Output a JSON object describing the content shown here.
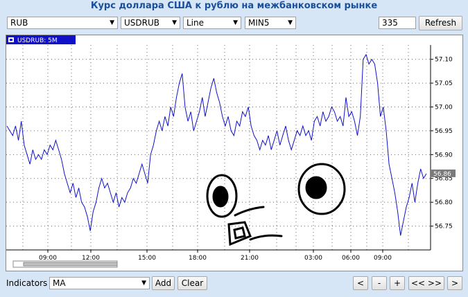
{
  "title": "Курс доллара США к рублю на межбанковском рынке",
  "toolbar": {
    "currency": "RUB",
    "pair": "USDRUB",
    "chart_type": "Line",
    "interval": "MIN5",
    "count": "335",
    "refresh_label": "Refresh"
  },
  "legend": {
    "label": "USDRUB: 5M"
  },
  "current_value_label": "56.86",
  "indicators": {
    "label": "Indicators",
    "selected": "MA",
    "add_label": "Add",
    "clear_label": "Clear"
  },
  "nav": {
    "back": "<",
    "zoom_out": "-",
    "zoom_in": "+",
    "expand": "<< >>",
    "forward": ">"
  },
  "colors": {
    "line": "#1010c8",
    "title": "#1a4f9c",
    "legend_bg": "#1010c8",
    "value_badge": "#7a7a7a"
  },
  "chart_data": {
    "type": "line",
    "series": [
      {
        "name": "USDRUB: 5M",
        "values": [
          56.96,
          56.95,
          56.94,
          56.96,
          56.93,
          56.97,
          56.92,
          56.9,
          56.88,
          56.91,
          56.89,
          56.9,
          56.89,
          56.91,
          56.9,
          56.92,
          56.91,
          56.93,
          56.91,
          56.89,
          56.86,
          56.84,
          56.82,
          56.84,
          56.81,
          56.83,
          56.8,
          56.79,
          56.77,
          56.74,
          56.78,
          56.8,
          56.83,
          56.85,
          56.83,
          56.84,
          56.82,
          56.8,
          56.82,
          56.79,
          56.81,
          56.8,
          56.82,
          56.83,
          56.85,
          56.84,
          56.86,
          56.88,
          56.86,
          56.84,
          56.9,
          56.92,
          56.95,
          56.97,
          56.95,
          56.98,
          56.96,
          57.0,
          56.98,
          57.02,
          57.05,
          57.07,
          57.0,
          56.97,
          56.99,
          56.95,
          56.97,
          56.99,
          57.02,
          56.98,
          57.01,
          57.04,
          57.06,
          57.03,
          57.01,
          56.98,
          56.96,
          56.98,
          56.95,
          56.94,
          56.97,
          56.96,
          56.99,
          56.98,
          57.0,
          56.96,
          56.94,
          56.93,
          56.91,
          56.93,
          56.92,
          56.94,
          56.91,
          56.93,
          56.95,
          56.92,
          56.94,
          56.96,
          56.93,
          56.91,
          56.93,
          56.95,
          56.94,
          56.96,
          56.94,
          56.95,
          56.93,
          56.97,
          56.98,
          56.96,
          56.99,
          56.97,
          56.98,
          57.0,
          56.99,
          56.97,
          56.98,
          56.96,
          57.02,
          56.98,
          56.99,
          56.97,
          56.94,
          56.98,
          57.1,
          57.11,
          57.09,
          57.1,
          57.09,
          57.05,
          56.98,
          57.0,
          56.95,
          56.88,
          56.85,
          56.82,
          56.78,
          56.73,
          56.76,
          56.79,
          56.81,
          56.84,
          56.8,
          56.84,
          56.87,
          56.85,
          56.86
        ]
      }
    ],
    "x_ticks": [
      "09:00",
      "12:00",
      "15:00",
      "18:00",
      "21:00",
      "03:00",
      "06:00",
      "09:00"
    ],
    "y_ticks": [
      "56.75",
      "56.80",
      "56.85",
      "56.90",
      "56.95",
      "57.00",
      "57.05",
      "57.10"
    ],
    "ylim": [
      56.7,
      57.13
    ],
    "grid": true
  }
}
